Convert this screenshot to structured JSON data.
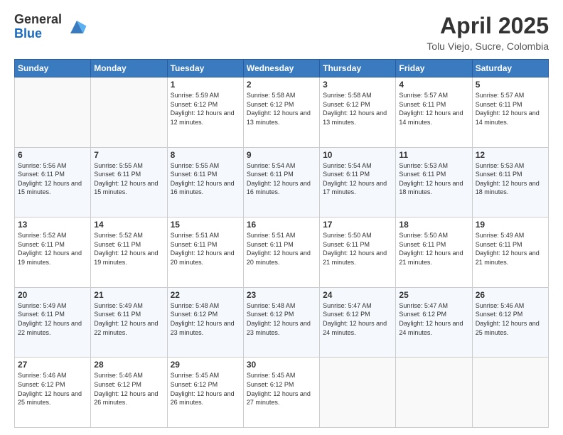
{
  "logo": {
    "general": "General",
    "blue": "Blue"
  },
  "header": {
    "title": "April 2025",
    "subtitle": "Tolu Viejo, Sucre, Colombia"
  },
  "weekdays": [
    "Sunday",
    "Monday",
    "Tuesday",
    "Wednesday",
    "Thursday",
    "Friday",
    "Saturday"
  ],
  "weeks": [
    [
      {
        "day": "",
        "info": ""
      },
      {
        "day": "",
        "info": ""
      },
      {
        "day": "1",
        "info": "Sunrise: 5:59 AM\nSunset: 6:12 PM\nDaylight: 12 hours and 12 minutes."
      },
      {
        "day": "2",
        "info": "Sunrise: 5:58 AM\nSunset: 6:12 PM\nDaylight: 12 hours and 13 minutes."
      },
      {
        "day": "3",
        "info": "Sunrise: 5:58 AM\nSunset: 6:12 PM\nDaylight: 12 hours and 13 minutes."
      },
      {
        "day": "4",
        "info": "Sunrise: 5:57 AM\nSunset: 6:11 PM\nDaylight: 12 hours and 14 minutes."
      },
      {
        "day": "5",
        "info": "Sunrise: 5:57 AM\nSunset: 6:11 PM\nDaylight: 12 hours and 14 minutes."
      }
    ],
    [
      {
        "day": "6",
        "info": "Sunrise: 5:56 AM\nSunset: 6:11 PM\nDaylight: 12 hours and 15 minutes."
      },
      {
        "day": "7",
        "info": "Sunrise: 5:55 AM\nSunset: 6:11 PM\nDaylight: 12 hours and 15 minutes."
      },
      {
        "day": "8",
        "info": "Sunrise: 5:55 AM\nSunset: 6:11 PM\nDaylight: 12 hours and 16 minutes."
      },
      {
        "day": "9",
        "info": "Sunrise: 5:54 AM\nSunset: 6:11 PM\nDaylight: 12 hours and 16 minutes."
      },
      {
        "day": "10",
        "info": "Sunrise: 5:54 AM\nSunset: 6:11 PM\nDaylight: 12 hours and 17 minutes."
      },
      {
        "day": "11",
        "info": "Sunrise: 5:53 AM\nSunset: 6:11 PM\nDaylight: 12 hours and 18 minutes."
      },
      {
        "day": "12",
        "info": "Sunrise: 5:53 AM\nSunset: 6:11 PM\nDaylight: 12 hours and 18 minutes."
      }
    ],
    [
      {
        "day": "13",
        "info": "Sunrise: 5:52 AM\nSunset: 6:11 PM\nDaylight: 12 hours and 19 minutes."
      },
      {
        "day": "14",
        "info": "Sunrise: 5:52 AM\nSunset: 6:11 PM\nDaylight: 12 hours and 19 minutes."
      },
      {
        "day": "15",
        "info": "Sunrise: 5:51 AM\nSunset: 6:11 PM\nDaylight: 12 hours and 20 minutes."
      },
      {
        "day": "16",
        "info": "Sunrise: 5:51 AM\nSunset: 6:11 PM\nDaylight: 12 hours and 20 minutes."
      },
      {
        "day": "17",
        "info": "Sunrise: 5:50 AM\nSunset: 6:11 PM\nDaylight: 12 hours and 21 minutes."
      },
      {
        "day": "18",
        "info": "Sunrise: 5:50 AM\nSunset: 6:11 PM\nDaylight: 12 hours and 21 minutes."
      },
      {
        "day": "19",
        "info": "Sunrise: 5:49 AM\nSunset: 6:11 PM\nDaylight: 12 hours and 21 minutes."
      }
    ],
    [
      {
        "day": "20",
        "info": "Sunrise: 5:49 AM\nSunset: 6:11 PM\nDaylight: 12 hours and 22 minutes."
      },
      {
        "day": "21",
        "info": "Sunrise: 5:49 AM\nSunset: 6:11 PM\nDaylight: 12 hours and 22 minutes."
      },
      {
        "day": "22",
        "info": "Sunrise: 5:48 AM\nSunset: 6:12 PM\nDaylight: 12 hours and 23 minutes."
      },
      {
        "day": "23",
        "info": "Sunrise: 5:48 AM\nSunset: 6:12 PM\nDaylight: 12 hours and 23 minutes."
      },
      {
        "day": "24",
        "info": "Sunrise: 5:47 AM\nSunset: 6:12 PM\nDaylight: 12 hours and 24 minutes."
      },
      {
        "day": "25",
        "info": "Sunrise: 5:47 AM\nSunset: 6:12 PM\nDaylight: 12 hours and 24 minutes."
      },
      {
        "day": "26",
        "info": "Sunrise: 5:46 AM\nSunset: 6:12 PM\nDaylight: 12 hours and 25 minutes."
      }
    ],
    [
      {
        "day": "27",
        "info": "Sunrise: 5:46 AM\nSunset: 6:12 PM\nDaylight: 12 hours and 25 minutes."
      },
      {
        "day": "28",
        "info": "Sunrise: 5:46 AM\nSunset: 6:12 PM\nDaylight: 12 hours and 26 minutes."
      },
      {
        "day": "29",
        "info": "Sunrise: 5:45 AM\nSunset: 6:12 PM\nDaylight: 12 hours and 26 minutes."
      },
      {
        "day": "30",
        "info": "Sunrise: 5:45 AM\nSunset: 6:12 PM\nDaylight: 12 hours and 27 minutes."
      },
      {
        "day": "",
        "info": ""
      },
      {
        "day": "",
        "info": ""
      },
      {
        "day": "",
        "info": ""
      }
    ]
  ]
}
